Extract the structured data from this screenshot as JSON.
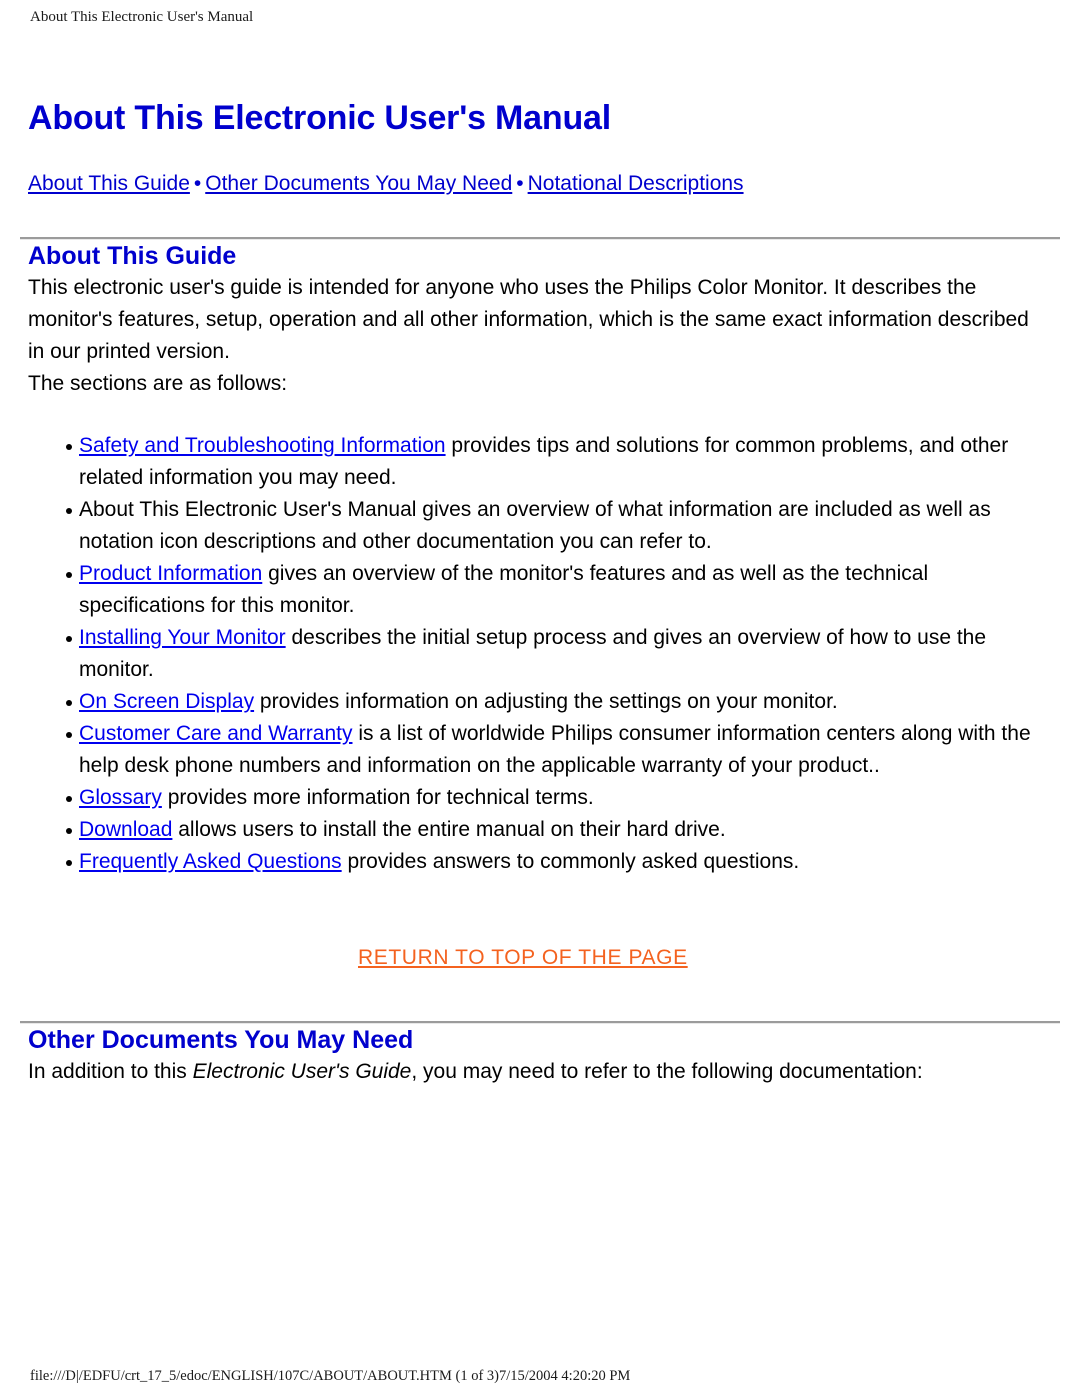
{
  "page": {
    "running_head": "About This Electronic User's Manual",
    "footer": "file:///D|/EDFU/crt_17_5/edoc/ENGLISH/107C/ABOUT/ABOUT.HTM (1 of 3)7/15/2004 4:20:20 PM"
  },
  "colors": {
    "heading_blue": "#0000cd",
    "link_blue": "#0000ee",
    "return_orange": "#f4621f",
    "rule_gray": "#9b9b9b",
    "text_black": "#000000",
    "background": "#ffffff"
  },
  "document": {
    "title": "About This Electronic User's Manual",
    "nav": {
      "separator": "•",
      "links": [
        "About This Guide",
        "Other Documents You May Need",
        "Notational Descriptions"
      ]
    },
    "section_about_guide": {
      "heading": "About This Guide",
      "intro_paragraph": "This electronic user's guide is intended for anyone who uses the Philips Color Monitor. It describes the monitor's features, setup, operation and all other information, which is the same exact information described in our printed version.",
      "list_lead_in": "The sections are as follows:",
      "items": [
        {
          "link": "Safety and Troubleshooting Information",
          "text": " provides tips and solutions for common problems, and other related information you may need."
        },
        {
          "link": "",
          "text": "About This Electronic User's Manual gives an overview of what information are included as well as notation icon descriptions and other documentation you can refer to."
        },
        {
          "link": "Product Information",
          "text": " gives an overview of the monitor's features and as well as the technical specifications for this monitor."
        },
        {
          "link": "Installing Your Monitor",
          "text": " describes the initial setup process and gives an overview of how to use the monitor."
        },
        {
          "link": "On Screen Display",
          "text": " provides information on adjusting the settings on your monitor."
        },
        {
          "link": "Customer Care and Warranty",
          "text": " is a list of worldwide Philips consumer information centers along with the help desk phone numbers and information on the applicable warranty of your product.."
        },
        {
          "link": "Glossary",
          "text": " provides more information for technical terms."
        },
        {
          "link": "Download",
          "text": " allows users to install the entire manual on their hard drive."
        },
        {
          "link": "Frequently Asked Questions",
          "text": " provides answers to commonly asked questions."
        }
      ],
      "return_to_top": "RETURN TO TOP OF THE PAGE"
    },
    "section_other_documents": {
      "heading": "Other Documents You May Need",
      "paragraph_before": "In addition to this ",
      "paragraph_italic": "Electronic User's Guide",
      "paragraph_after": ", you may need to refer to the following documentation:"
    }
  }
}
